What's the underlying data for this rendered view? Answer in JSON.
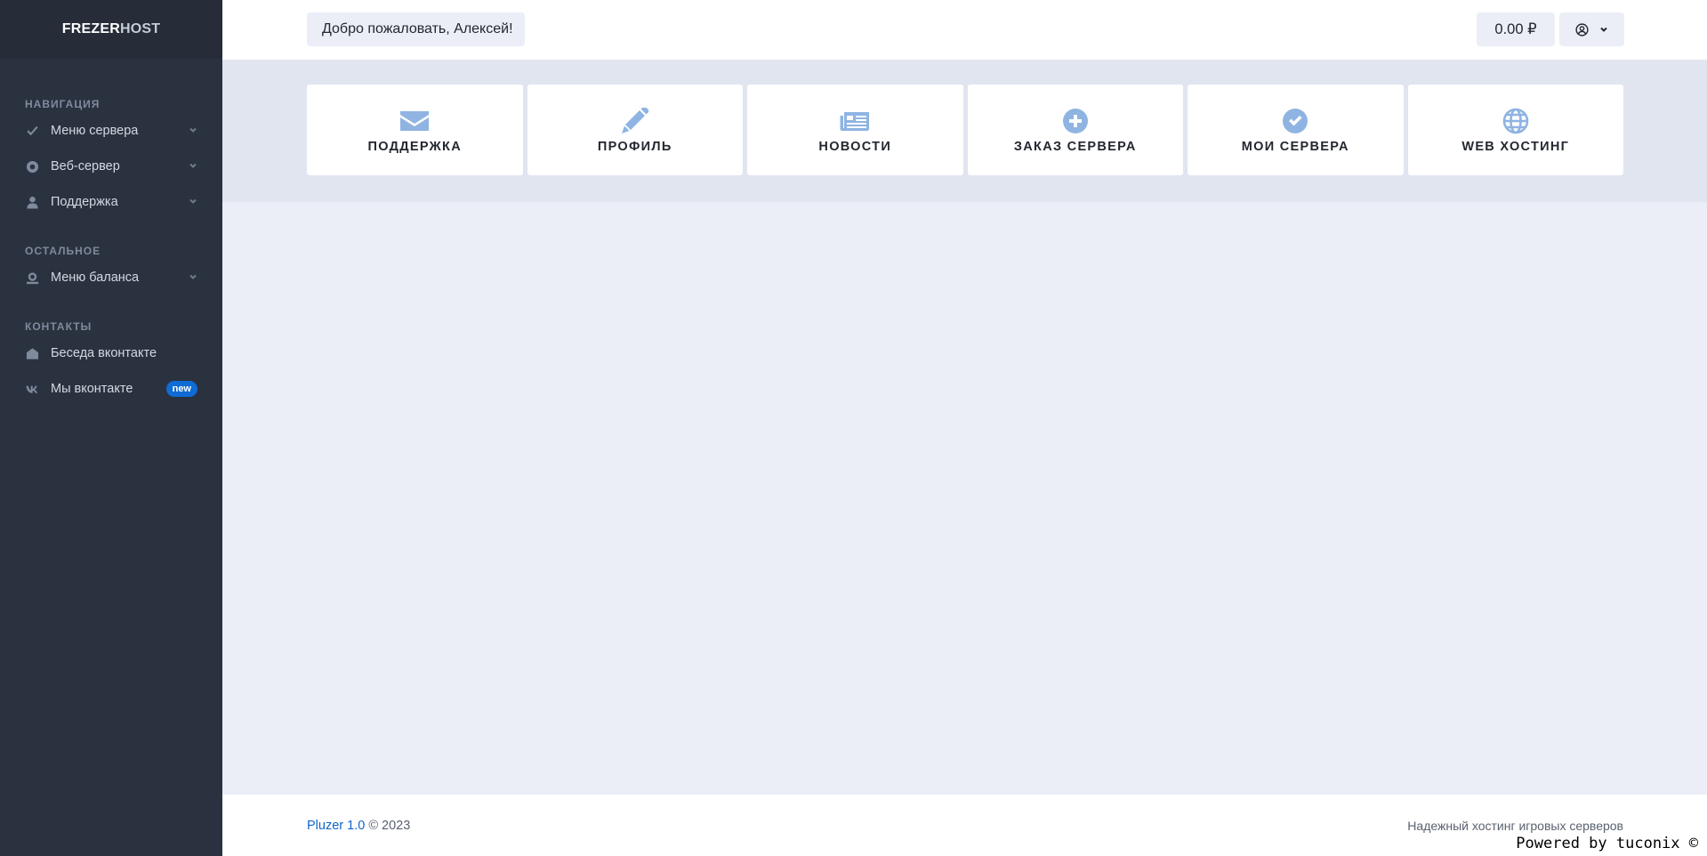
{
  "brand": {
    "part1": "FREZER",
    "part2": "HOST"
  },
  "sidebar": {
    "sections": [
      {
        "heading": "Навигация",
        "items": [
          {
            "label": "Меню сервера",
            "icon": "check-icon",
            "has_chevron": true
          },
          {
            "label": "Веб-сервер",
            "icon": "life-ring-icon",
            "has_chevron": true
          },
          {
            "label": "Поддержка",
            "icon": "user-icon",
            "has_chevron": true
          }
        ]
      },
      {
        "heading": "Остальное",
        "items": [
          {
            "label": "Меню баланса",
            "icon": "wallet-icon",
            "has_chevron": true
          }
        ]
      },
      {
        "heading": "Контакты",
        "items": [
          {
            "label": "Беседа вконтакте",
            "icon": "envelope-open-icon",
            "has_chevron": false
          },
          {
            "label": "Мы вконтакте",
            "icon": "vk-icon",
            "has_chevron": false,
            "badge": "new"
          }
        ]
      }
    ]
  },
  "header": {
    "welcome": "Добро пожаловать, Алексей!",
    "balance": "0.00 ₽"
  },
  "tiles": [
    {
      "label": "Поддержка",
      "icon": "envelope-icon"
    },
    {
      "label": "Профиль",
      "icon": "pencil-icon"
    },
    {
      "label": "Новости",
      "icon": "newspaper-icon"
    },
    {
      "label": "Заказ сервера",
      "icon": "plus-circle-icon"
    },
    {
      "label": "Мои сервера",
      "icon": "check-circle-icon"
    },
    {
      "label": "Web хостинг",
      "icon": "globe-icon"
    }
  ],
  "footer": {
    "app_name": "Pluzer 1.0",
    "copyright": "© 2023",
    "tagline": "Надежный хостинг игровых серверов",
    "powered": "Powered by tuconix ©"
  },
  "colors": {
    "sidebar_bg": "#2b323f",
    "accent": "#1066c8",
    "tile_icon": "#8fb4e2",
    "page_bg": "#ebeef7"
  }
}
